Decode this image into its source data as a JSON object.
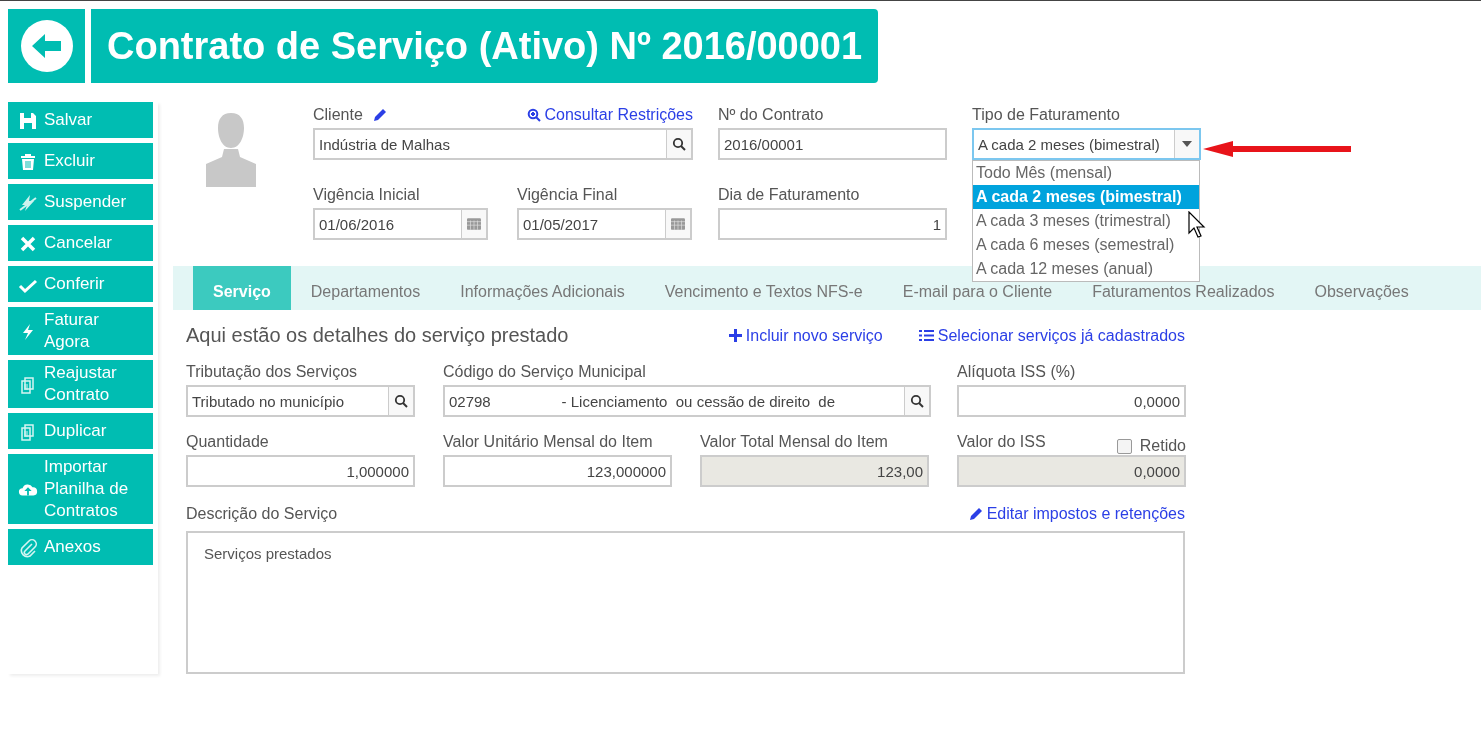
{
  "header": {
    "title": "Contrato de Serviço (Ativo) Nº 2016/00001"
  },
  "actions": [
    {
      "label": "Salvar",
      "kind": "save"
    },
    {
      "label": "Excluir",
      "kind": "trash"
    },
    {
      "label": "Suspender",
      "kind": "bolt-off"
    },
    {
      "label": "Cancelar",
      "kind": "x"
    },
    {
      "label": "Conferir",
      "kind": "check"
    },
    {
      "label": "Faturar Agora",
      "kind": "bolt"
    },
    {
      "label": "Reajustar Contrato",
      "kind": "copy"
    },
    {
      "label": "Duplicar",
      "kind": "copy"
    },
    {
      "label": "Importar Planilha de Contratos",
      "kind": "upload"
    },
    {
      "label": "Anexos",
      "kind": "clip"
    }
  ],
  "client": {
    "label": "Cliente",
    "link": "Consultar Restrições",
    "value": "Indústria de Malhas"
  },
  "contract_number": {
    "label": "Nº do Contrato",
    "value": "2016/00001"
  },
  "billing_type": {
    "label": "Tipo de Faturamento",
    "value": "A cada 2 meses (bimestral)",
    "expanded": true,
    "options": [
      {
        "label": "Todo Mês (mensal)",
        "selected": false
      },
      {
        "label": "A cada 2 meses (bimestral)",
        "selected": true
      },
      {
        "label": "A cada 3 meses (trimestral)",
        "selected": false
      },
      {
        "label": "A cada 6 meses (semestral)",
        "selected": false
      },
      {
        "label": "A cada 12 meses (anual)",
        "selected": false
      }
    ]
  },
  "start_date": {
    "label": "Vigência Inicial",
    "value": "01/06/2016"
  },
  "end_date": {
    "label": "Vigência Final",
    "value": "01/05/2017"
  },
  "billing_day": {
    "label": "Dia de Faturamento",
    "value": "1"
  },
  "tabs": [
    {
      "label": "Serviço",
      "selected": true
    },
    {
      "label": "Departamentos",
      "selected": false
    },
    {
      "label": "Informações Adicionais",
      "selected": false
    },
    {
      "label": "Vencimento e Textos NFS-e",
      "selected": false
    },
    {
      "label": "E-mail para o Cliente",
      "selected": false
    },
    {
      "label": "Faturamentos Realizados",
      "selected": false
    },
    {
      "label": "Observações",
      "selected": false
    }
  ],
  "service": {
    "heading": "Aqui estão os detalhes do serviço prestado",
    "links": [
      {
        "label": "Incluir novo serviço",
        "kind": "plus"
      },
      {
        "label": "Selecionar serviços já cadastrados",
        "kind": "list"
      }
    ],
    "fields": [
      {
        "label": "Tributação dos Serviços",
        "value": "Tributado no município",
        "kind": "lookup"
      },
      {
        "label": "Código do Serviço Municipal",
        "value": "02798                 - Licenciamento  ou cessão de direito  de",
        "kind": "lookup-wide"
      },
      {
        "label": "Alíquota ISS (%)",
        "value": "0,0000",
        "kind": "number"
      },
      {
        "label": "Quantidade",
        "value": "1,000000",
        "kind": "number"
      },
      {
        "label": "Valor Unitário Mensal do Item",
        "value": "123,000000",
        "kind": "number"
      },
      {
        "label": "Valor Total Mensal do Item",
        "value": "123,00",
        "kind": "readonly"
      },
      {
        "label": "Valor do ISS",
        "value": "0,0000",
        "kind": "readonly",
        "retained": {
          "label": "Retido",
          "checked": false
        }
      }
    ],
    "edit_link": "Editar impostos e retenções",
    "description": {
      "label": "Descrição do Serviço",
      "value": "Serviços prestados"
    }
  }
}
